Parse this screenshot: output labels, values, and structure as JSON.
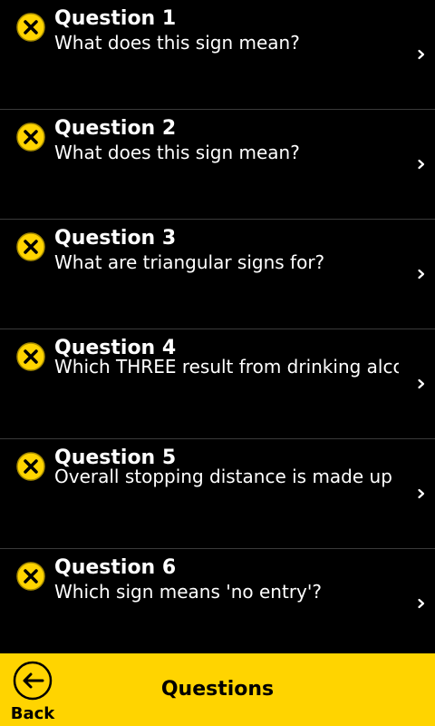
{
  "questions": [
    {
      "title": "Question 1",
      "text": "What does this sign mean?",
      "status": "incorrect",
      "status_icon": "close-circle-icon"
    },
    {
      "title": "Question 2",
      "text": "What does this sign mean?",
      "status": "incorrect",
      "status_icon": "close-circle-icon"
    },
    {
      "title": "Question 3",
      "text": "What are triangular signs for?",
      "status": "incorrect",
      "status_icon": "close-circle-icon"
    },
    {
      "title": "Question 4",
      "text": "Which THREE result from drinking alcohol?",
      "status": "incorrect",
      "status_icon": "close-circle-icon"
    },
    {
      "title": "Question 5",
      "text": "Overall stopping distance is made up of thinking and braking distance. You",
      "status": "incorrect",
      "status_icon": "close-circle-icon"
    },
    {
      "title": "Question 6",
      "text": "Which sign means 'no entry'?",
      "status": "incorrect",
      "status_icon": "close-circle-icon"
    }
  ],
  "bottom_bar": {
    "back_label": "Back",
    "title": "Questions",
    "back_icon": "back-arrow-circle-icon",
    "background_color": "#ffd400"
  },
  "colors": {
    "status_yellow": "#ffd400",
    "background": "#000000",
    "text": "#ffffff"
  }
}
